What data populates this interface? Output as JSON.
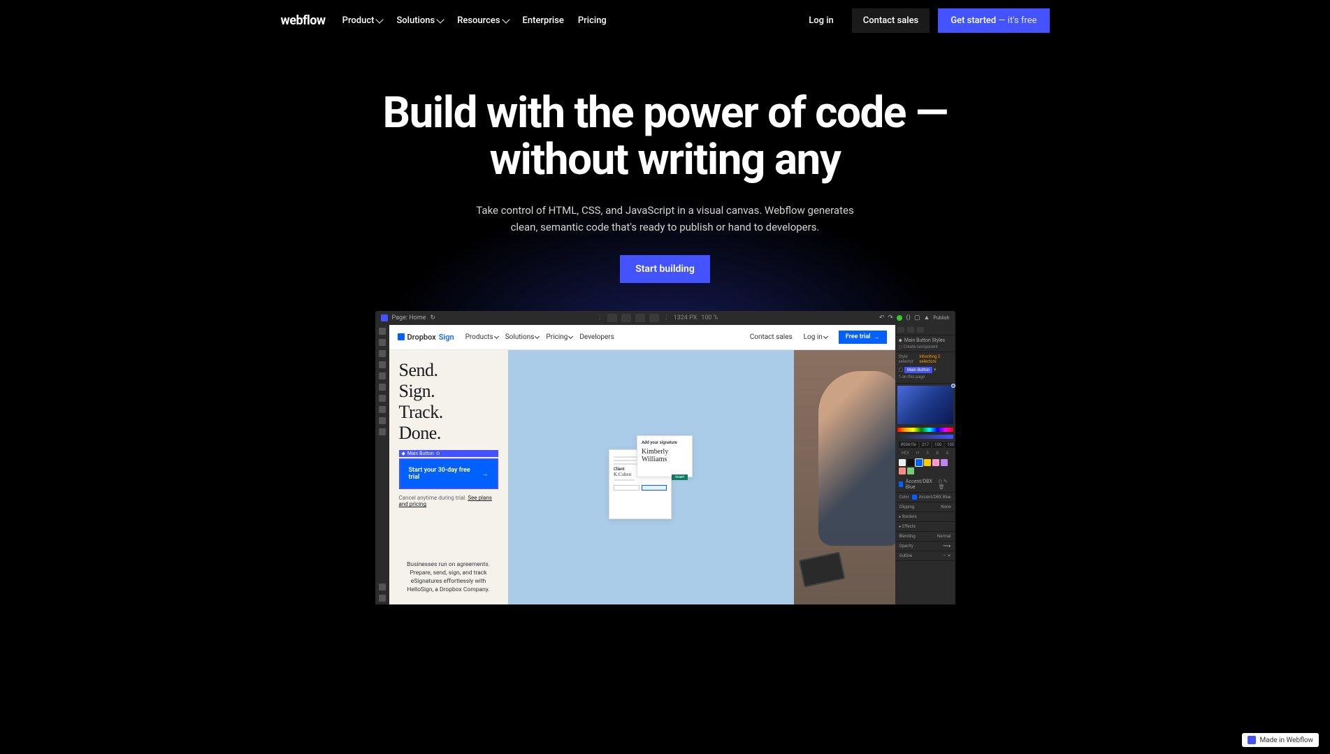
{
  "nav": {
    "logo": "webflow",
    "links": [
      {
        "label": "Product",
        "chevron": true
      },
      {
        "label": "Solutions",
        "chevron": true
      },
      {
        "label": "Resources",
        "chevron": true
      },
      {
        "label": "Enterprise",
        "chevron": false
      },
      {
        "label": "Pricing",
        "chevron": false
      }
    ],
    "login": "Log in",
    "contact": "Contact sales",
    "get_started": "Get started",
    "get_started_sub": " — it's free"
  },
  "hero": {
    "title": "Build with the power of code — without writing any",
    "subtitle": "Take control of HTML, CSS, and JavaScript in a visual canvas. Webflow generates clean, semantic code that's ready to publish or hand to developers.",
    "cta": "Start building"
  },
  "editor": {
    "topbar": {
      "page_label": "Page: Home",
      "dimension": "1324 PX",
      "zoom": "100 %",
      "publish": "Publish"
    },
    "canvas": {
      "brand_name": "Dropbox",
      "brand_suffix": "Sign",
      "nav": [
        "Products",
        "Solutions",
        "Pricing",
        "Developers"
      ],
      "nav_right": {
        "contact": "Contact sales",
        "login": "Log in",
        "free_trial": "Free trial"
      },
      "heading": "Send.\nSign.\nTrack.\nDone.",
      "main_button_tag": "Main Button",
      "main_button": "Start your 30-day free trial",
      "cancel_text": "Cancel anytime during trial. ",
      "cancel_link": "See plans and pricing",
      "biz_text": "Businesses run on agreements. Prepare, send, sign, and track eSignatures effortlessly with HelloSign, a Dropbox Company.",
      "card_add_sig": "Add your signature",
      "card_client": "Client"
    },
    "panel": {
      "main_button_styles": "Main Button Styles",
      "create_component": "Create component",
      "style_selector": "Style selector",
      "inheriting": "Inheriting 2 selectors",
      "main_button_chip": "Main Button",
      "on_page": "1 on this page",
      "hex_value": "#0061fe",
      "hex_cells": [
        "217",
        "100",
        "100",
        "100"
      ],
      "format_labels": [
        "HEX",
        "H",
        "S",
        "B",
        "A"
      ],
      "swatches": [
        "#eee",
        "#111",
        "#0061fe",
        "#fc0",
        "#f9c",
        "#b8e",
        "#f88",
        "#7c7"
      ],
      "accent_label": "Accent/DBX Blue",
      "accent_label2": "Accent/DBX Blue",
      "clipping": "Clipping",
      "clipping_val": "None",
      "borders": "Borders",
      "effects": "Effects",
      "blending": "Blending",
      "blending_val": "Normal",
      "opacity": "Opacity",
      "outline": "Outline"
    }
  },
  "badge": "Made in Webflow"
}
